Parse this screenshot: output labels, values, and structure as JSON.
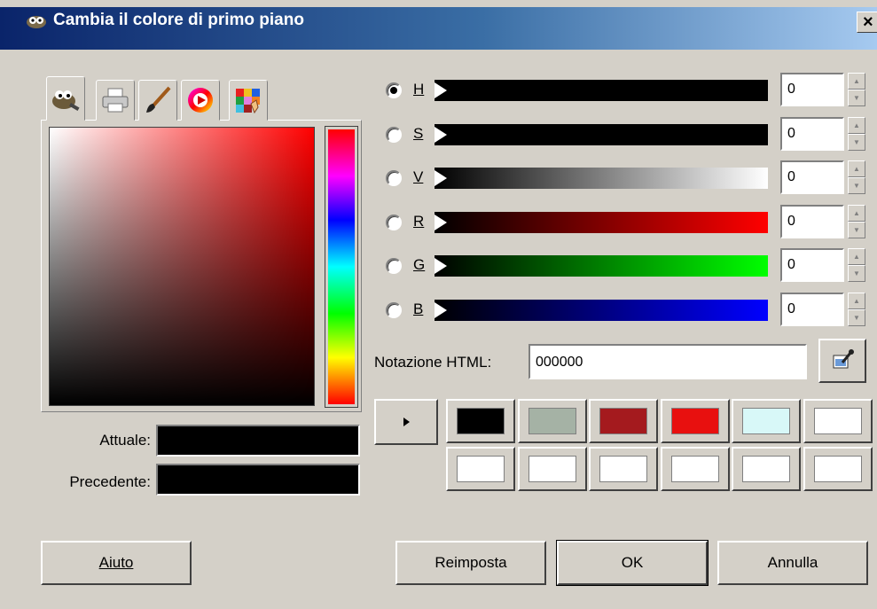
{
  "window": {
    "title": "Cambia il colore di primo piano",
    "close_label": "×"
  },
  "tabs": [
    {
      "name": "gimp-selector",
      "icon": "gimp-wilber-icon"
    },
    {
      "name": "cmyk-selector",
      "icon": "printer-icon"
    },
    {
      "name": "watercolor-selector",
      "icon": "paintbrush-icon"
    },
    {
      "name": "triangle-selector",
      "icon": "color-wheel-icon"
    },
    {
      "name": "palette-selector",
      "icon": "palette-icon"
    }
  ],
  "colors": {
    "accent_red": "#ff0000",
    "current": "#000000",
    "previous": "#000000"
  },
  "current_label": "Attuale:",
  "previous_label": "Precedente:",
  "channels": [
    {
      "key": "H",
      "label": "H",
      "value": "0",
      "selected": true
    },
    {
      "key": "S",
      "label": "S",
      "value": "0",
      "selected": false
    },
    {
      "key": "V",
      "label": "V",
      "value": "0",
      "selected": false
    },
    {
      "key": "R",
      "label": "R",
      "value": "0",
      "selected": false
    },
    {
      "key": "G",
      "label": "G",
      "value": "0",
      "selected": false
    },
    {
      "key": "B",
      "label": "B",
      "value": "0",
      "selected": false
    }
  ],
  "html_notation": {
    "label": "Notazione HTML:",
    "value": "000000"
  },
  "history": {
    "row1": [
      "#000000",
      "#a5b2a5",
      "#a41a1e",
      "#e8100f",
      "#d8f8f8",
      "#ffffff"
    ],
    "row2": [
      "#ffffff",
      "#ffffff",
      "#ffffff",
      "#ffffff",
      "#ffffff",
      "#ffffff"
    ]
  },
  "buttons": {
    "help": "Aiuto",
    "reset": "Reimposta",
    "ok": "OK",
    "cancel": "Annulla"
  }
}
